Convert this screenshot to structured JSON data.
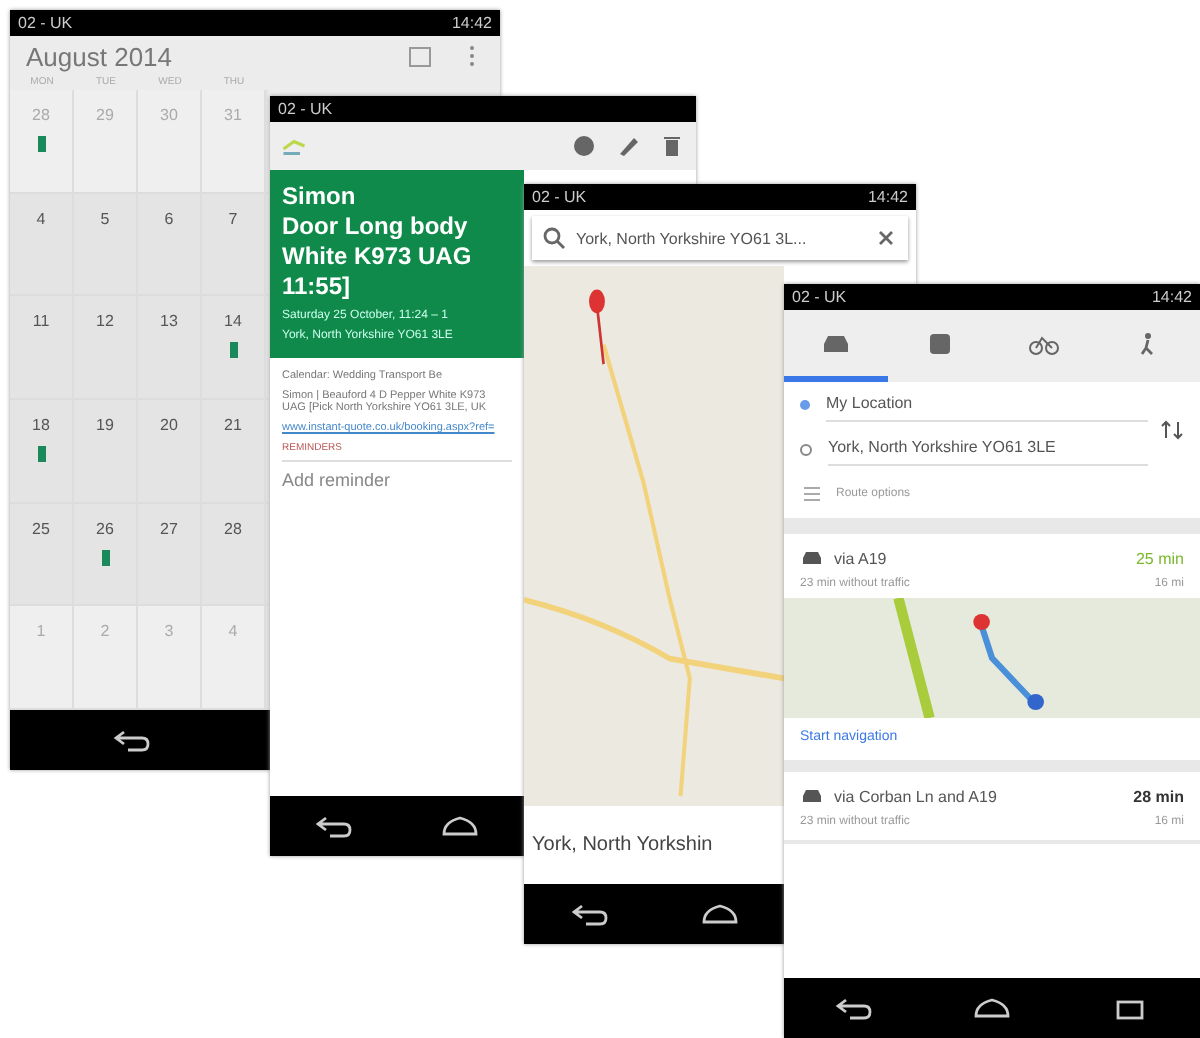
{
  "calendar_screen": {
    "status_bar": {
      "carrier": "02 - UK",
      "time": "14:42"
    },
    "title": "August 2014",
    "weekdays": [
      "MON",
      "TUE",
      "WED",
      "THU"
    ],
    "weeks": [
      [
        {
          "day": "28",
          "event": true,
          "muted": true
        },
        {
          "day": "29",
          "event": false,
          "muted": true
        },
        {
          "day": "30",
          "event": false,
          "muted": true
        },
        {
          "day": "31",
          "event": false,
          "muted": true
        }
      ],
      [
        {
          "day": "4",
          "event": false,
          "muted": false
        },
        {
          "day": "5",
          "event": false,
          "muted": false
        },
        {
          "day": "6",
          "event": false,
          "muted": false
        },
        {
          "day": "7",
          "event": false,
          "muted": false
        }
      ],
      [
        {
          "day": "11",
          "event": false,
          "muted": false
        },
        {
          "day": "12",
          "event": false,
          "muted": false
        },
        {
          "day": "13",
          "event": false,
          "muted": false
        },
        {
          "day": "14",
          "event": true,
          "muted": false
        }
      ],
      [
        {
          "day": "18",
          "event": true,
          "muted": false
        },
        {
          "day": "19",
          "event": false,
          "muted": false
        },
        {
          "day": "20",
          "event": false,
          "muted": false
        },
        {
          "day": "21",
          "event": false,
          "muted": false
        }
      ],
      [
        {
          "day": "25",
          "event": false,
          "muted": false
        },
        {
          "day": "26",
          "event": true,
          "muted": false
        },
        {
          "day": "27",
          "event": false,
          "muted": false
        },
        {
          "day": "28",
          "event": false,
          "muted": false
        }
      ],
      [
        {
          "day": "1",
          "event": false,
          "muted": true
        },
        {
          "day": "2",
          "event": false,
          "muted": true
        },
        {
          "day": "3",
          "event": false,
          "muted": true
        },
        {
          "day": "4",
          "event": false,
          "muted": true
        }
      ]
    ]
  },
  "event_screen": {
    "status_bar": {
      "carrier": "02 - UK"
    },
    "title_lines": [
      "Simon",
      "Door Long body",
      "White   K973 UAG",
      "11:55]"
    ],
    "when": "Saturday 25 October, 11:24 – 1",
    "where": "York, North Yorkshire YO61 3LE",
    "calendar": "Calendar: Wedding Transport Be",
    "description": "Simon | Beauford  4 D Pepper White  K973 UAG [Pick North Yorkshire YO61 3LE, UK",
    "link": "www.instant-quote.co.uk/booking.aspx?ref=",
    "reminders_heading": "REMINDERS",
    "add_reminder": "Add reminder"
  },
  "map_screen": {
    "status_bar": {
      "carrier": "02 - UK",
      "time": "14:42"
    },
    "search": {
      "value": "York, North Yorkshire YO61 3L..."
    },
    "place_title": "York, North Yorkshin"
  },
  "directions_screen": {
    "status_bar": {
      "carrier": "02 - UK",
      "time": "14:42"
    },
    "modes": [
      {
        "kind": "car",
        "selected": true
      },
      {
        "kind": "transit",
        "selected": false
      },
      {
        "kind": "bike",
        "selected": false
      },
      {
        "kind": "walk",
        "selected": false
      }
    ],
    "from": "My Location",
    "to": "York, North Yorkshire YO61 3LE",
    "route_options": "Route options",
    "routes": [
      {
        "via": "via A19",
        "duration": "25 min",
        "traffic_note": "23 min without traffic",
        "distance": "16 mi",
        "fast": true,
        "map": true,
        "start_navigation": "Start navigation"
      },
      {
        "via": "via Corban Ln and A19",
        "duration": "28 min",
        "traffic_note": "23 min without traffic",
        "distance": "16 mi",
        "fast": false,
        "map": false
      }
    ]
  }
}
